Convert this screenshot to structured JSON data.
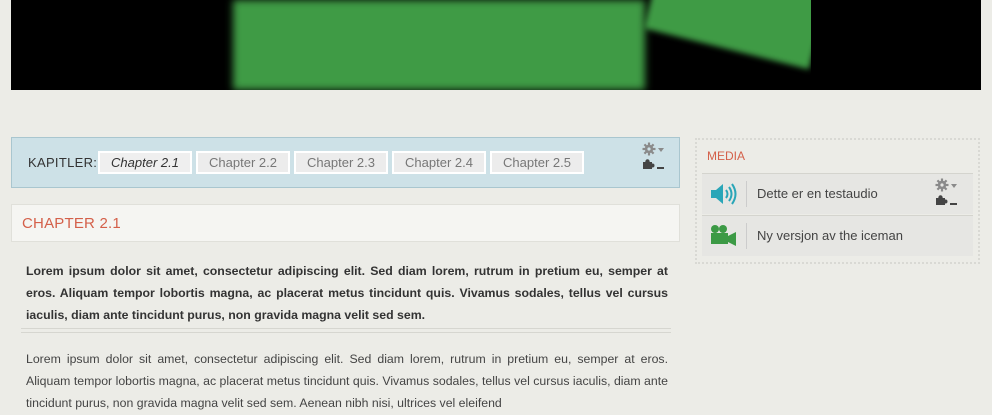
{
  "chapters": {
    "label": "KAPITLER:",
    "tabs": [
      {
        "label": "Chapter 2.1",
        "active": true
      },
      {
        "label": "Chapter 2.2",
        "active": false
      },
      {
        "label": "Chapter 2.3",
        "active": false
      },
      {
        "label": "Chapter 2.4",
        "active": false
      },
      {
        "label": "Chapter 2.5",
        "active": false
      }
    ]
  },
  "chapter": {
    "title": "CHAPTER 2.1",
    "lead": "Lorem ipsum dolor sit amet, consectetur adipiscing elit. Sed diam lorem, rutrum in pretium eu, semper at eros. Aliquam tempor lobortis magna, ac placerat metus tincidunt quis. Vivamus sodales, tellus vel cursus iaculis, diam ante tincidunt purus, non gravida magna velit sed sem.",
    "body": "Lorem ipsum dolor sit amet, consectetur adipiscing elit. Sed diam lorem, rutrum in pretium eu, semper at eros. Aliquam tempor lobortis magna, ac placerat metus tincidunt quis. Vivamus sodales, tellus vel cursus iaculis, diam ante tincidunt purus, non gravida magna velit sed sem. Aenean nibh nisi, ultrices vel eleifend"
  },
  "media": {
    "title": "MEDIA",
    "items": [
      {
        "label": "Dette er en testaudio",
        "icon": "speaker-icon"
      },
      {
        "label": "Ny versjon av the iceman",
        "icon": "video-camera-icon"
      }
    ]
  },
  "colors": {
    "accent": "#d4604a",
    "chapters_bg": "#cde1e7",
    "audio_icon": "#2aa6b8",
    "video_icon": "#3c9a45",
    "page_bg": "#ecece7"
  }
}
